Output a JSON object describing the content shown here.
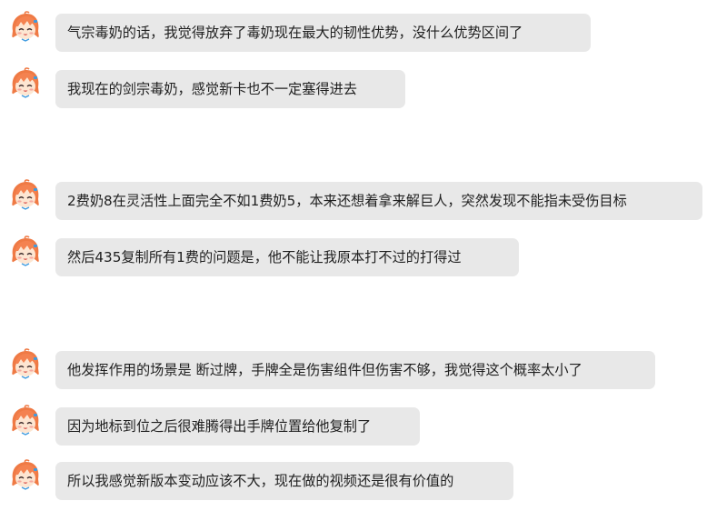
{
  "messages": [
    {
      "text": "气宗毒奶的话，我觉得放弃了毒奶现在最大的韧性优势，没什么优势区间了"
    },
    {
      "text": "我现在的剑宗毒奶，感觉新卡也不一定塞得进去"
    },
    {
      "text": "2费奶8在灵活性上面完全不如1费奶5，本来还想着拿来解巨人，突然发现不能指未受伤目标"
    },
    {
      "text": "然后435复制所有1费的问题是，他不能让我原本打不过的打得过"
    },
    {
      "text": "他发挥作用的场景是 断过牌，手牌全是伤害组件但伤害不够，我觉得这个概率太小了"
    },
    {
      "text": "因为地标到位之后很难腾得出手牌位置给他复制了"
    },
    {
      "text": "所以我感觉新版本变动应该不大，现在做的视频还是很有价值的"
    }
  ],
  "colors": {
    "bubble_bg": "#e8e8e8",
    "text": "#1f1f1f",
    "avatar_hair": "#f07c4a",
    "avatar_skin": "#fde6d2",
    "avatar_accent": "#3d9be0"
  },
  "icons": {
    "avatar": "anime-girl-avatar-icon"
  }
}
